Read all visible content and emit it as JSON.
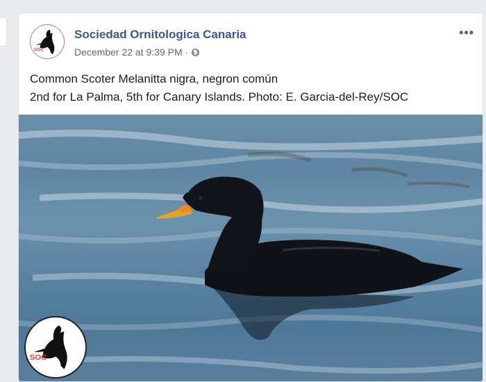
{
  "post": {
    "author": "Sociedad Ornitologica Canaria",
    "timestamp": "December 22 at 9:39 PM",
    "separator": "·",
    "privacy_icon": "globe-icon",
    "more_icon": "more-options-icon",
    "more_label": "•••",
    "caption_line1": "Common Scoter Melanitta nigra, negron común",
    "caption_line2": "2nd for La Palma, 5th for Canary Islands. Photo: E. Garcia-del-Rey/SOC"
  },
  "logo": {
    "text": "SOC",
    "text_color": "#e8412c"
  },
  "colors": {
    "link": "#365899",
    "meta": "#606770",
    "text": "#1c1e21",
    "background": "#e9ebee"
  }
}
